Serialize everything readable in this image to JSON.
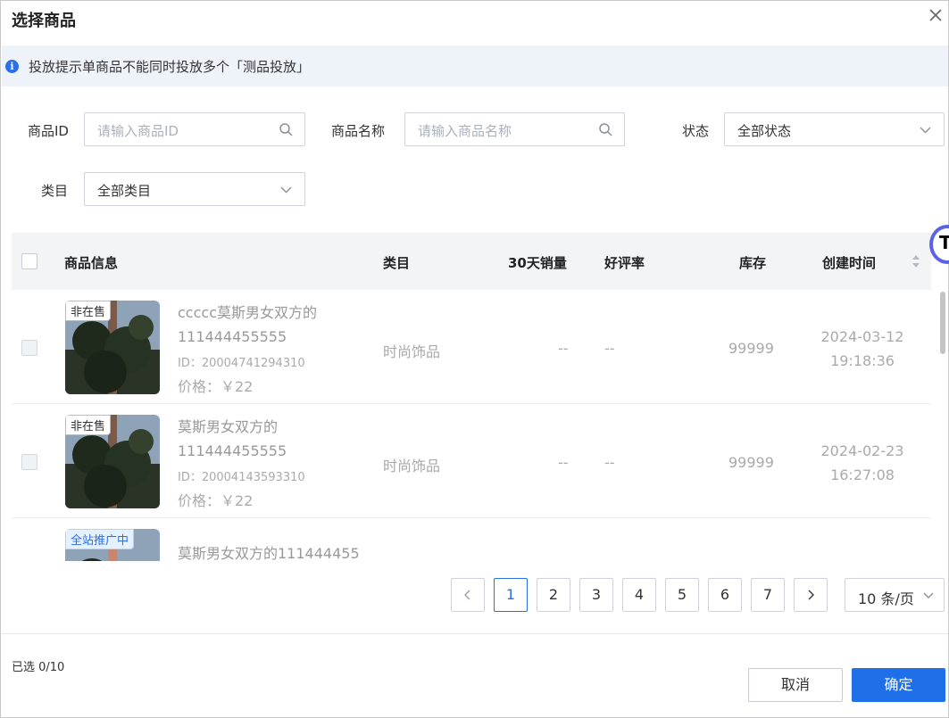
{
  "dialog": {
    "title": "选择商品"
  },
  "notice": {
    "text": "投放提示单商品不能同时投放多个「测品投放」"
  },
  "filters": {
    "product_id": {
      "label": "商品ID",
      "placeholder": "请输入商品ID"
    },
    "product_name": {
      "label": "商品名称",
      "placeholder": "请输入商品名称"
    },
    "status": {
      "label": "状态",
      "value": "全部状态"
    },
    "category": {
      "label": "类目",
      "value": "全部类目"
    }
  },
  "table": {
    "headers": [
      "商品信息",
      "类目",
      "30天销量",
      "好评率",
      "库存",
      "创建时间"
    ],
    "rows": [
      {
        "tag": "非在售",
        "name_line1": "ccccc莫斯男女双方的",
        "name_line2": "111444455555",
        "id": "ID：20004741294310",
        "price": "价格：￥22",
        "category": "时尚饰品",
        "sales": "--",
        "rating": "--",
        "stock": "99999",
        "date": "2024-03-12",
        "time": "19:18:36"
      },
      {
        "tag": "非在售",
        "name_line1": "莫斯男女双方的",
        "name_line2": "111444455555",
        "id": "ID：20004143593310",
        "price": "价格：￥22",
        "category": "时尚饰品",
        "sales": "--",
        "rating": "--",
        "stock": "99999",
        "date": "2024-02-23",
        "time": "16:27:08"
      },
      {
        "tag": "全站推广中",
        "name_line1": "莫斯男女双方的111444455",
        "name_line2": "",
        "id": "",
        "price": "",
        "category": "",
        "sales": "",
        "rating": "",
        "stock": "",
        "date": "",
        "time": ""
      }
    ]
  },
  "pagination": {
    "pages": [
      "1",
      "2",
      "3",
      "4",
      "5",
      "6",
      "7"
    ],
    "current": "1",
    "page_size": "10 条/页"
  },
  "footer": {
    "selected": "已选 0/10",
    "cancel": "取消",
    "confirm": "确定"
  },
  "colors": {
    "primary": "#1f6fe8",
    "notice_bg": "#eef2f9",
    "header_bg": "#f3f4f6"
  },
  "icons": [
    "info-icon",
    "close-icon",
    "search-icon",
    "chevron-down-icon",
    "sort-icon",
    "chevron-left-icon",
    "chevron-right-icon"
  ]
}
